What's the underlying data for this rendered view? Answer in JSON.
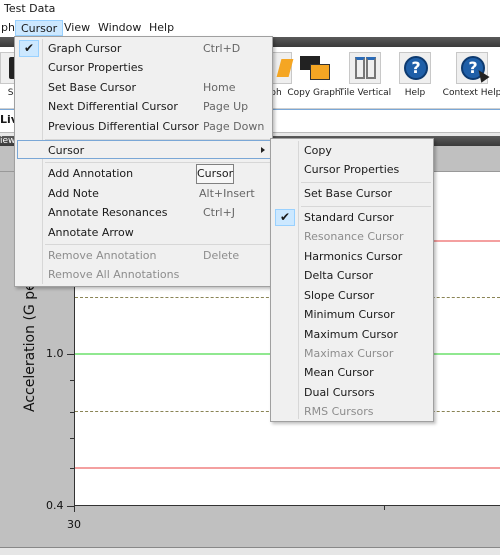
{
  "window": {
    "title": "Test Data"
  },
  "menubar": {
    "items": [
      {
        "label": "ph"
      },
      {
        "label": "Cursor",
        "active": true
      },
      {
        "label": "View"
      },
      {
        "label": "Window"
      },
      {
        "label": "Help"
      }
    ]
  },
  "toolbar": {
    "buttons": [
      {
        "label": "Sav",
        "icon": "save-icon"
      },
      {
        "label": "ph",
        "icon": "graph-icon"
      },
      {
        "label": "Copy Graph",
        "icon": "copy-graph-icon"
      },
      {
        "label": "Tile Vertical",
        "icon": "tile-vertical-icon"
      },
      {
        "label": "Help",
        "icon": "help-icon"
      },
      {
        "label": "Context Help",
        "icon": "context-help-icon"
      }
    ]
  },
  "live_tab": {
    "label": "Liv"
  },
  "view_header": {
    "label": "iew"
  },
  "cursor_menu": {
    "items": [
      {
        "label": "Graph Cursor",
        "shortcut": "Ctrl+D",
        "checked": true,
        "enabled": true
      },
      {
        "label": "Cursor Properties",
        "shortcut": "",
        "enabled": true
      },
      {
        "label": "Set Base Cursor",
        "shortcut": "Home",
        "enabled": true
      },
      {
        "label": "Next Differential Cursor",
        "shortcut": "Page Up",
        "enabled": true
      },
      {
        "label": "Previous Differential Cursor",
        "shortcut": "Page Down",
        "enabled": true
      },
      {
        "label": "Cursor",
        "shortcut": "",
        "submenu": true,
        "highlighted": true,
        "enabled": true
      },
      {
        "label": "Add Annotation",
        "shortcut": "",
        "enabled": true
      },
      {
        "label": "Add Note",
        "shortcut": "Alt+Insert",
        "enabled": true
      },
      {
        "label": "Annotate Resonances",
        "shortcut": "Ctrl+J",
        "enabled": true
      },
      {
        "label": "Annotate Arrow",
        "shortcut": "",
        "enabled": true
      },
      {
        "label": "Remove Annotation",
        "shortcut": "Delete",
        "enabled": false
      },
      {
        "label": "Remove All Annotations",
        "shortcut": "",
        "enabled": false
      }
    ]
  },
  "tooltip": {
    "text": "Cursor"
  },
  "cursor_submenu": {
    "items": [
      {
        "label": "Copy",
        "enabled": true
      },
      {
        "label": "Cursor Properties",
        "enabled": true
      },
      {
        "label": "Set Base Cursor",
        "enabled": true
      },
      {
        "label": "Standard Cursor",
        "enabled": true,
        "checked": true
      },
      {
        "label": "Resonance Cursor",
        "enabled": false
      },
      {
        "label": "Harmonics Cursor",
        "enabled": true
      },
      {
        "label": "Delta Cursor",
        "enabled": true
      },
      {
        "label": "Slope Cursor",
        "enabled": true
      },
      {
        "label": "Minimum Cursor",
        "enabled": true
      },
      {
        "label": "Maximum Cursor",
        "enabled": true
      },
      {
        "label": "Maximax Cursor",
        "enabled": false
      },
      {
        "label": "Mean Cursor",
        "enabled": true
      },
      {
        "label": "Dual Cursors",
        "enabled": true
      },
      {
        "label": "RMS Cursors",
        "enabled": false
      }
    ]
  },
  "graph": {
    "ylabel": "Acceleration (G pea",
    "y_tick_labels": [
      "1.0",
      "0.4"
    ],
    "x_tick_labels": [
      "30"
    ],
    "colors": {
      "upper_abort": "#f4a0a0",
      "control": "#80e080",
      "alarm": "#8a8455",
      "lower_abort": "#f4a0a0"
    }
  }
}
